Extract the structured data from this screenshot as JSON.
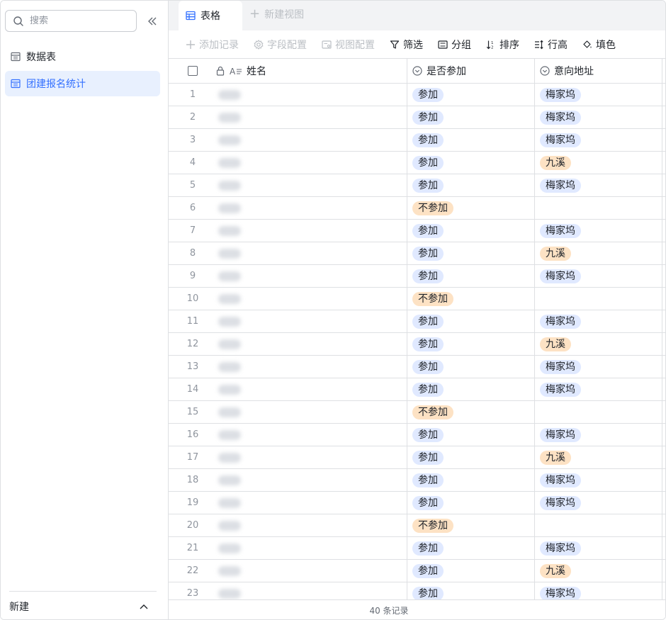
{
  "sidebar": {
    "search_placeholder": "搜索",
    "items": [
      {
        "label": "数据表",
        "active": false
      },
      {
        "label": "团建报名统计",
        "active": true
      }
    ],
    "footer_label": "新建"
  },
  "tabs": {
    "active_label": "表格",
    "new_view_label": "新建视图"
  },
  "toolbar": {
    "add_record": "添加记录",
    "field_config": "字段配置",
    "view_config": "视图配置",
    "filter": "筛选",
    "group": "分组",
    "sort": "排序",
    "row_height": "行高",
    "fill_color": "填色"
  },
  "columns": {
    "name": "姓名",
    "attend": "是否参加",
    "location": "意向地址"
  },
  "rows": [
    {
      "idx": "1",
      "attend": "参加",
      "location": "梅家坞"
    },
    {
      "idx": "2",
      "attend": "参加",
      "location": "梅家坞"
    },
    {
      "idx": "3",
      "attend": "参加",
      "location": "梅家坞"
    },
    {
      "idx": "4",
      "attend": "参加",
      "location": "九溪"
    },
    {
      "idx": "5",
      "attend": "参加",
      "location": "梅家坞"
    },
    {
      "idx": "6",
      "attend": "不参加",
      "location": ""
    },
    {
      "idx": "7",
      "attend": "参加",
      "location": "梅家坞"
    },
    {
      "idx": "8",
      "attend": "参加",
      "location": "九溪"
    },
    {
      "idx": "9",
      "attend": "参加",
      "location": "梅家坞"
    },
    {
      "idx": "10",
      "attend": "不参加",
      "location": ""
    },
    {
      "idx": "11",
      "attend": "参加",
      "location": "梅家坞"
    },
    {
      "idx": "12",
      "attend": "参加",
      "location": "九溪"
    },
    {
      "idx": "13",
      "attend": "参加",
      "location": "梅家坞"
    },
    {
      "idx": "14",
      "attend": "参加",
      "location": "梅家坞"
    },
    {
      "idx": "15",
      "attend": "不参加",
      "location": ""
    },
    {
      "idx": "16",
      "attend": "参加",
      "location": "梅家坞"
    },
    {
      "idx": "17",
      "attend": "参加",
      "location": "九溪"
    },
    {
      "idx": "18",
      "attend": "参加",
      "location": "梅家坞"
    },
    {
      "idx": "19",
      "attend": "参加",
      "location": "梅家坞"
    },
    {
      "idx": "20",
      "attend": "不参加",
      "location": ""
    },
    {
      "idx": "21",
      "attend": "参加",
      "location": "梅家坞"
    },
    {
      "idx": "22",
      "attend": "参加",
      "location": "九溪"
    },
    {
      "idx": "23",
      "attend": "参加",
      "location": "梅家坞"
    }
  ],
  "footer": {
    "record_count": "40 条记录"
  },
  "colors": {
    "accent": "#3370ff",
    "tag_blue": "#e0e9ff",
    "tag_orange": "#fde2c4"
  }
}
